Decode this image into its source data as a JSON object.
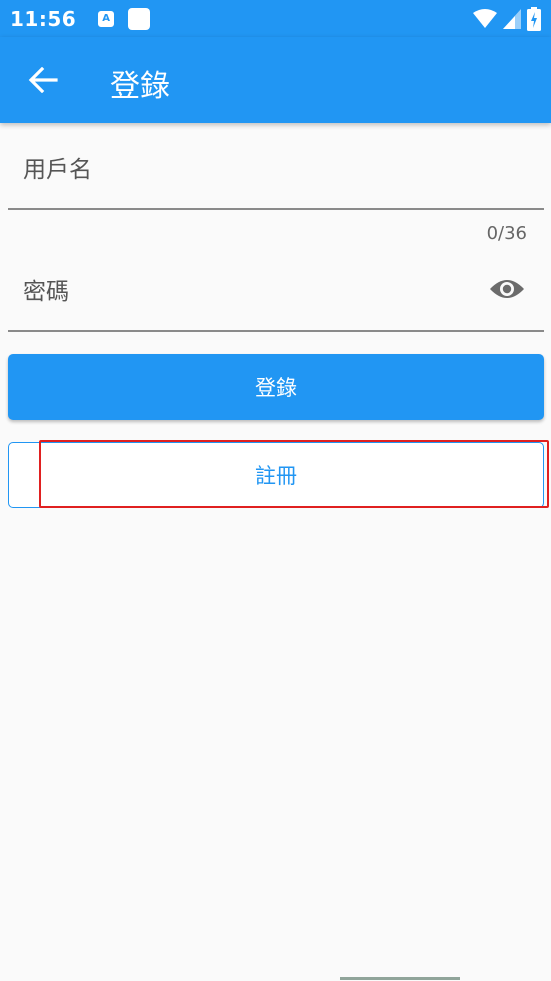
{
  "status_bar": {
    "time": "11:56",
    "notif_letter": "A"
  },
  "app_bar": {
    "title": "登錄"
  },
  "form": {
    "username_label": "用戶名",
    "counter": "0/36",
    "password_label": "密碼"
  },
  "buttons": {
    "login_label": "登錄",
    "register_label": "註冊"
  },
  "colors": {
    "primary": "#2196f3",
    "highlight": "#e02020"
  },
  "icons": [
    "back-arrow-icon",
    "eye-icon",
    "wifi-icon",
    "signal-icon",
    "battery-icon"
  ]
}
